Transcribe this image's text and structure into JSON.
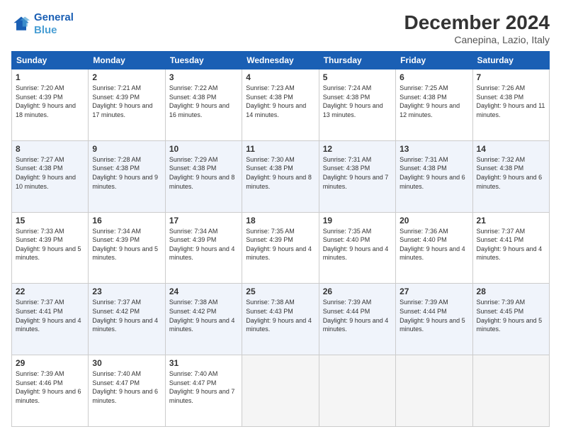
{
  "header": {
    "logo_line1": "General",
    "logo_line2": "Blue",
    "title": "December 2024",
    "subtitle": "Canepina, Lazio, Italy"
  },
  "days_of_week": [
    "Sunday",
    "Monday",
    "Tuesday",
    "Wednesday",
    "Thursday",
    "Friday",
    "Saturday"
  ],
  "weeks": [
    [
      {
        "day": 1,
        "sunrise": "7:20 AM",
        "sunset": "4:39 PM",
        "daylight": "9 hours and 18 minutes."
      },
      {
        "day": 2,
        "sunrise": "7:21 AM",
        "sunset": "4:39 PM",
        "daylight": "9 hours and 17 minutes."
      },
      {
        "day": 3,
        "sunrise": "7:22 AM",
        "sunset": "4:38 PM",
        "daylight": "9 hours and 16 minutes."
      },
      {
        "day": 4,
        "sunrise": "7:23 AM",
        "sunset": "4:38 PM",
        "daylight": "9 hours and 14 minutes."
      },
      {
        "day": 5,
        "sunrise": "7:24 AM",
        "sunset": "4:38 PM",
        "daylight": "9 hours and 13 minutes."
      },
      {
        "day": 6,
        "sunrise": "7:25 AM",
        "sunset": "4:38 PM",
        "daylight": "9 hours and 12 minutes."
      },
      {
        "day": 7,
        "sunrise": "7:26 AM",
        "sunset": "4:38 PM",
        "daylight": "9 hours and 11 minutes."
      }
    ],
    [
      {
        "day": 8,
        "sunrise": "7:27 AM",
        "sunset": "4:38 PM",
        "daylight": "9 hours and 10 minutes."
      },
      {
        "day": 9,
        "sunrise": "7:28 AM",
        "sunset": "4:38 PM",
        "daylight": "9 hours and 9 minutes."
      },
      {
        "day": 10,
        "sunrise": "7:29 AM",
        "sunset": "4:38 PM",
        "daylight": "9 hours and 8 minutes."
      },
      {
        "day": 11,
        "sunrise": "7:30 AM",
        "sunset": "4:38 PM",
        "daylight": "9 hours and 8 minutes."
      },
      {
        "day": 12,
        "sunrise": "7:31 AM",
        "sunset": "4:38 PM",
        "daylight": "9 hours and 7 minutes."
      },
      {
        "day": 13,
        "sunrise": "7:31 AM",
        "sunset": "4:38 PM",
        "daylight": "9 hours and 6 minutes."
      },
      {
        "day": 14,
        "sunrise": "7:32 AM",
        "sunset": "4:38 PM",
        "daylight": "9 hours and 6 minutes."
      }
    ],
    [
      {
        "day": 15,
        "sunrise": "7:33 AM",
        "sunset": "4:39 PM",
        "daylight": "9 hours and 5 minutes."
      },
      {
        "day": 16,
        "sunrise": "7:34 AM",
        "sunset": "4:39 PM",
        "daylight": "9 hours and 5 minutes."
      },
      {
        "day": 17,
        "sunrise": "7:34 AM",
        "sunset": "4:39 PM",
        "daylight": "9 hours and 4 minutes."
      },
      {
        "day": 18,
        "sunrise": "7:35 AM",
        "sunset": "4:39 PM",
        "daylight": "9 hours and 4 minutes."
      },
      {
        "day": 19,
        "sunrise": "7:35 AM",
        "sunset": "4:40 PM",
        "daylight": "9 hours and 4 minutes."
      },
      {
        "day": 20,
        "sunrise": "7:36 AM",
        "sunset": "4:40 PM",
        "daylight": "9 hours and 4 minutes."
      },
      {
        "day": 21,
        "sunrise": "7:37 AM",
        "sunset": "4:41 PM",
        "daylight": "9 hours and 4 minutes."
      }
    ],
    [
      {
        "day": 22,
        "sunrise": "7:37 AM",
        "sunset": "4:41 PM",
        "daylight": "9 hours and 4 minutes."
      },
      {
        "day": 23,
        "sunrise": "7:37 AM",
        "sunset": "4:42 PM",
        "daylight": "9 hours and 4 minutes."
      },
      {
        "day": 24,
        "sunrise": "7:38 AM",
        "sunset": "4:42 PM",
        "daylight": "9 hours and 4 minutes."
      },
      {
        "day": 25,
        "sunrise": "7:38 AM",
        "sunset": "4:43 PM",
        "daylight": "9 hours and 4 minutes."
      },
      {
        "day": 26,
        "sunrise": "7:39 AM",
        "sunset": "4:44 PM",
        "daylight": "9 hours and 4 minutes."
      },
      {
        "day": 27,
        "sunrise": "7:39 AM",
        "sunset": "4:44 PM",
        "daylight": "9 hours and 5 minutes."
      },
      {
        "day": 28,
        "sunrise": "7:39 AM",
        "sunset": "4:45 PM",
        "daylight": "9 hours and 5 minutes."
      }
    ],
    [
      {
        "day": 29,
        "sunrise": "7:39 AM",
        "sunset": "4:46 PM",
        "daylight": "9 hours and 6 minutes."
      },
      {
        "day": 30,
        "sunrise": "7:40 AM",
        "sunset": "4:47 PM",
        "daylight": "9 hours and 6 minutes."
      },
      {
        "day": 31,
        "sunrise": "7:40 AM",
        "sunset": "4:47 PM",
        "daylight": "9 hours and 7 minutes."
      },
      null,
      null,
      null,
      null
    ]
  ]
}
